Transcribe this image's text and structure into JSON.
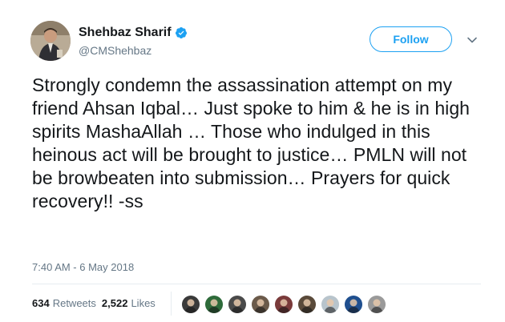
{
  "author": {
    "name": "Shehbaz Sharif",
    "handle": "@CMShehbaz",
    "verified_icon": "verified-badge-icon",
    "avatar_icon": "avatar"
  },
  "follow_button": {
    "label": "Follow"
  },
  "menu_icon": "chevron-down-icon",
  "tweet": {
    "text": "Strongly condemn the assassination attempt on my friend Ahsan Iqbal… Just spoke to him & he is in high spirits MashaAllah … Those who indulged in this heinous act will be brought to justice… PMLN will not be browbeaten into submission… Prayers for quick recovery!! -ss",
    "timestamp": "7:40 AM - 6 May 2018"
  },
  "stats": {
    "retweets_count": "634",
    "retweets_label": "Retweets",
    "likes_count": "2,522",
    "likes_label": "Likes"
  },
  "liker_avatars": [
    {
      "name": "liker-avatar-1",
      "color": "#3a3a3a"
    },
    {
      "name": "liker-avatar-2",
      "color": "#2e6b3a"
    },
    {
      "name": "liker-avatar-3",
      "color": "#4a4a4a"
    },
    {
      "name": "liker-avatar-4",
      "color": "#6b5a4a"
    },
    {
      "name": "liker-avatar-5",
      "color": "#7a3a3a"
    },
    {
      "name": "liker-avatar-6",
      "color": "#5a4a3a"
    },
    {
      "name": "liker-avatar-7",
      "color": "#b8c4cc"
    },
    {
      "name": "liker-avatar-8",
      "color": "#1f4f8f"
    },
    {
      "name": "liker-avatar-9",
      "color": "#9a9a9a"
    }
  ],
  "colors": {
    "accent": "#1da1f2",
    "text": "#14171a",
    "secondary": "#657786",
    "divider": "#e6ecf0"
  }
}
